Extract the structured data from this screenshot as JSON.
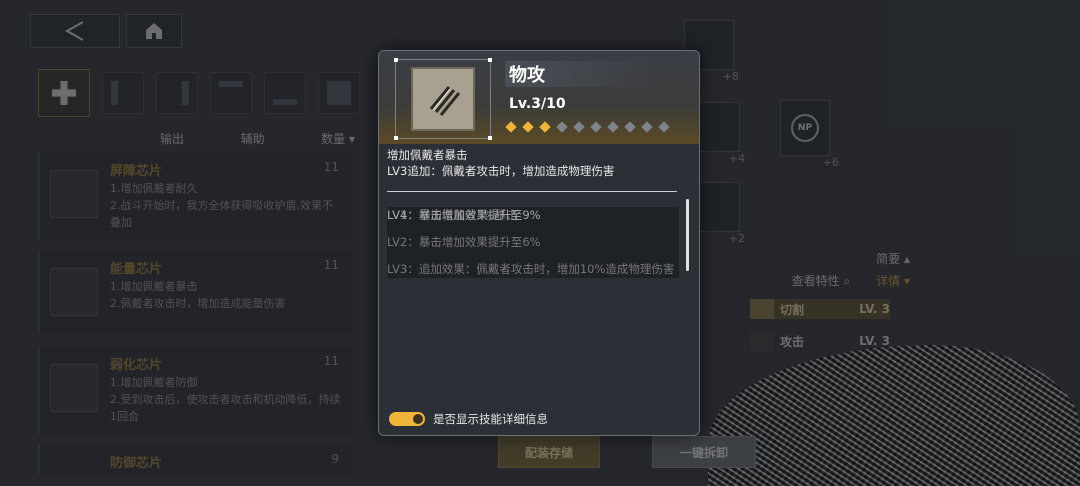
{
  "sorts": [
    "输出",
    "辅助",
    "数量 ▾"
  ],
  "chips": [
    {
      "name": "屏障芯片",
      "count": "11",
      "lines": [
        "1.增加佩戴者耐久",
        "2.战斗开始时，我方全体获得吸收护盾,效果不叠加"
      ]
    },
    {
      "name": "能量芯片",
      "count": "11",
      "lines": [
        "1.增加佩戴者暴击",
        "2.佩戴者攻击时，增加造成能量伤害"
      ]
    },
    {
      "name": "弱化芯片",
      "count": "11",
      "lines": [
        "1.增加佩戴者防御",
        "2.受到攻击后，使攻击者攻击和机动降低，持续1回合"
      ]
    },
    {
      "name": "防御芯片",
      "count": "9",
      "lines": []
    }
  ],
  "nodes": {
    "plus1": "+8",
    "plus2": "+4",
    "plus3": "+2",
    "np_label": "NP",
    "np_plus": "+6"
  },
  "right_panel": {
    "summary": "简要",
    "view_traits": "查看特性",
    "details": "详情"
  },
  "stats": [
    {
      "label": "切割",
      "level": "LV. 3"
    },
    {
      "label": "攻击",
      "level": "LV. 3"
    }
  ],
  "buttons": {
    "save": "配装存储",
    "remove": "一键拆卸"
  },
  "popup": {
    "title": "物攻",
    "level": "Lv.3/10",
    "pips_on": 3,
    "pips_total": 10,
    "desc1": "增加佩戴者暴击",
    "desc2": "LV3追加：佩戴者攻击时，增加造成物理伤害",
    "levels": [
      {
        "text": "LV1：增加佩戴者3%暴击",
        "dim": false
      },
      {
        "text": "LV2：暴击增加效果提升至6%",
        "dim": false
      },
      {
        "text": "LV3：追加效果：佩戴者攻击时，增加10%造成物理伤害",
        "dim": false
      },
      {
        "text": "LV4：暴击增加效果提升至9%",
        "dim": true
      }
    ],
    "toggle_label": "是否显示技能详细信息"
  },
  "colors": {
    "accent": "#f0b43a",
    "chip_name": "#a08040",
    "highlight": "#5f5534"
  }
}
